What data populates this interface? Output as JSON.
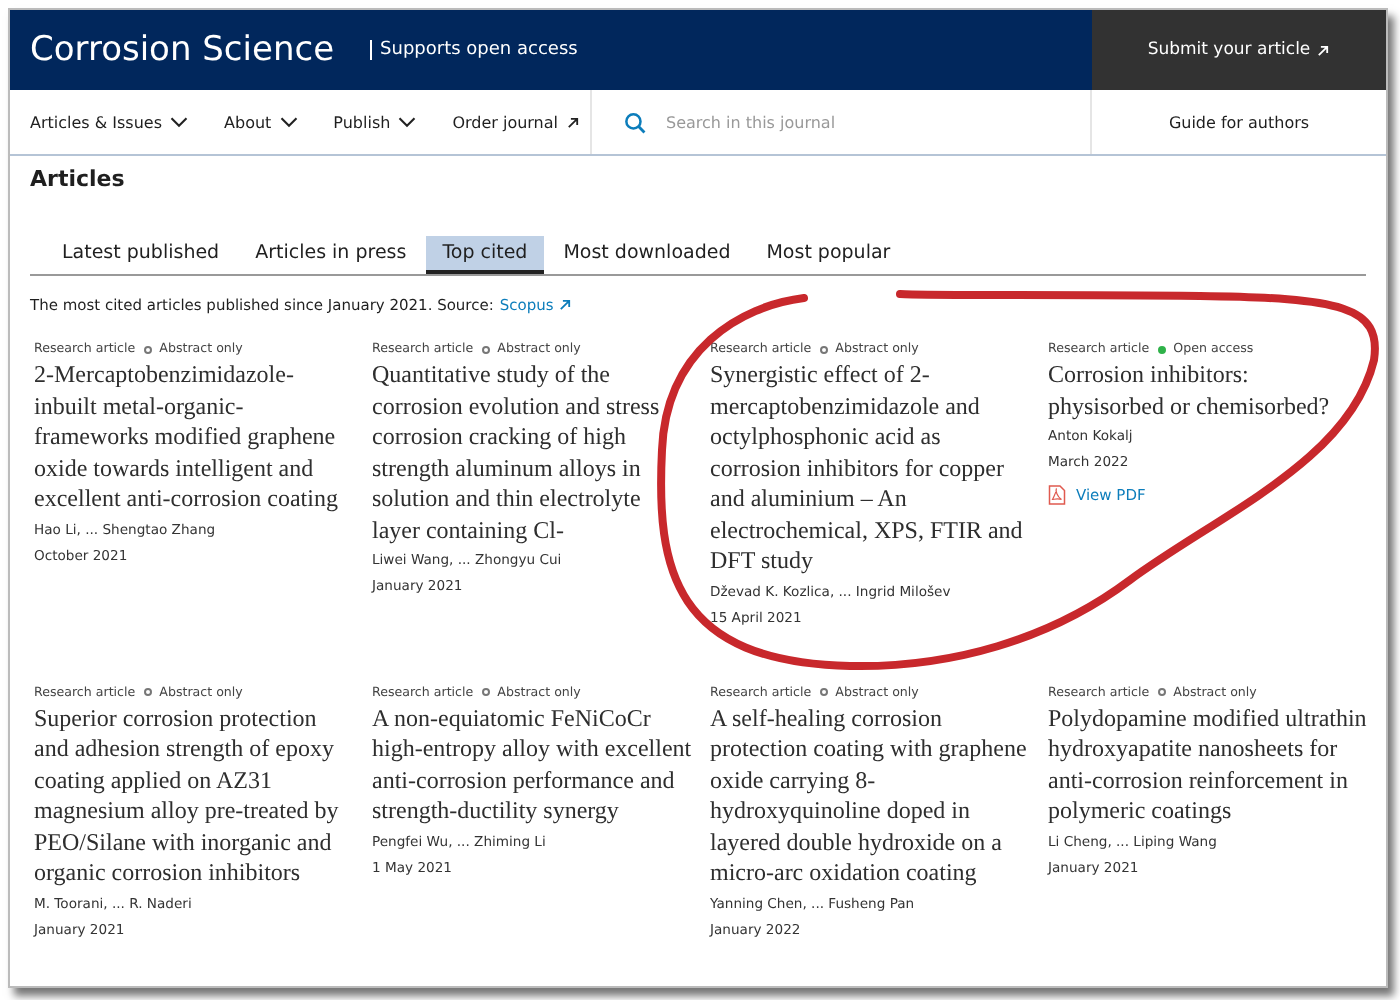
{
  "header": {
    "journal": "Corrosion Science",
    "tagline": "Supports open access",
    "submit": "Submit your article"
  },
  "nav": {
    "items": [
      {
        "label": "Articles & Issues",
        "kind": "menu"
      },
      {
        "label": "About",
        "kind": "menu"
      },
      {
        "label": "Publish",
        "kind": "menu"
      },
      {
        "label": "Order journal",
        "kind": "external"
      }
    ],
    "search": {
      "placeholder": "Search in this journal"
    },
    "guide": "Guide for authors"
  },
  "section_title": "Articles",
  "tabs": [
    {
      "label": "Latest published",
      "selected": false
    },
    {
      "label": "Articles in press",
      "selected": false
    },
    {
      "label": "Top cited",
      "selected": true
    },
    {
      "label": "Most downloaded",
      "selected": false
    },
    {
      "label": "Most popular",
      "selected": false
    }
  ],
  "intro": {
    "text": "The most cited articles published since January 2021. Source:",
    "link": "Scopus"
  },
  "articles": [
    {
      "type": "Research article",
      "access": "Abstract only",
      "open_access": false,
      "title": "2-Mercaptobenzimidazole-inbuilt metal-organic-frameworks modified graphene oxide towards intelligent and excellent anti-corrosion coating",
      "authors": "Hao Li, ... Shengtao Zhang",
      "date": "October 2021"
    },
    {
      "type": "Research article",
      "access": "Abstract only",
      "open_access": false,
      "title": "Quantitative study of the corrosion evolution and stress corrosion cracking of high strength aluminum alloys in solution and thin electrolyte layer containing Cl-",
      "authors": "Liwei Wang, ... Zhongyu Cui",
      "date": "January 2021"
    },
    {
      "type": "Research article",
      "access": "Abstract only",
      "open_access": false,
      "title": "Synergistic effect of 2-mercaptobenzimidazole and octylphosphonic acid as corrosion inhibitors for copper and aluminium – An electrochemical, XPS, FTIR and DFT study",
      "authors": "Dževad K. Kozlica, ... Ingrid Milošev",
      "date": "15 April 2021"
    },
    {
      "type": "Research article",
      "access": "Open access",
      "open_access": true,
      "title": "Corrosion inhibitors: physisorbed or chemisorbed?",
      "authors": "Anton Kokalj",
      "date": "March 2022",
      "pdf": "View PDF"
    },
    {
      "type": "Research article",
      "access": "Abstract only",
      "open_access": false,
      "title": "Superior corrosion protection and adhesion strength of epoxy coating applied on AZ31 magnesium alloy pre-treated by PEO/Silane with inorganic and organic corrosion inhibitors",
      "authors": "M. Toorani, ... R. Naderi",
      "date": "January 2021"
    },
    {
      "type": "Research article",
      "access": "Abstract only",
      "open_access": false,
      "title": "A non-equiatomic FeNiCoCr high-entropy alloy with excellent anti-corrosion performance and strength-ductility synergy",
      "authors": "Pengfei Wu, ... Zhiming Li",
      "date": "1 May 2021"
    },
    {
      "type": "Research article",
      "access": "Abstract only",
      "open_access": false,
      "title": "A self-healing corrosion protection coating with graphene oxide carrying 8-hydroxyquinoline doped in layered double hydroxide on a micro-arc oxidation coating",
      "authors": "Yanning Chen, ... Fusheng Pan",
      "date": "January 2022"
    },
    {
      "type": "Research article",
      "access": "Abstract only",
      "open_access": false,
      "title": "Polydopamine modified ultrathin hydroxyapatite nanosheets for anti-corrosion reinforcement in polymeric coatings",
      "authors": "Li Cheng, ... Liping Wang",
      "date": "January 2021"
    }
  ]
}
